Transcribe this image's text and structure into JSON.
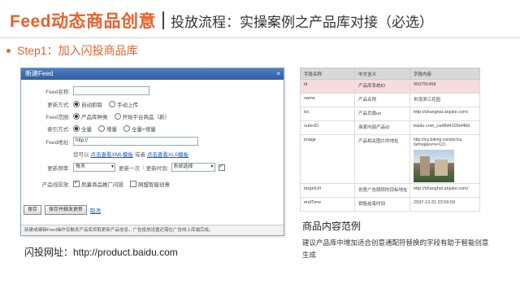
{
  "header": {
    "title_main": "Feed动态商品创意",
    "title_sub": "投放流程：实操案例之产品库对接（必选）"
  },
  "step": "Step1：加入闪投商品库",
  "dialog": {
    "title": "新建Feed",
    "close": "×",
    "feed_name_label": "Feed名称:",
    "update_mode_label": "更新方式:",
    "update_auto": "自动抓取",
    "update_manual": "手动上传",
    "scope_label": "Feed范围:",
    "scope_lib": "产品库种类",
    "scope_platform": "开始平台商品（新）",
    "index_label": "索引方式:",
    "index_full": "全量",
    "index_inc": "增量",
    "index_full_inc": "全量+增量",
    "addr_label": "Feed地址:",
    "addr_value": "http://",
    "tpl_prefix": "您可以",
    "tpl_xml": "点击查看XML模板",
    "tpl_or": "或者",
    "tpl_xls": "点击查看XLS模板",
    "freq_label": "更新频率:",
    "freq_value": "每天",
    "freq_once": "更新一次",
    "freq_until": "更新时到:",
    "freq_select": "系统选择",
    "product_label": "产品线投放:",
    "product_chk1": "凤巢商品推广闪投",
    "product_chk2": "网盟智能创意",
    "save": "保存",
    "save_update": "保存并触发更新",
    "cancel": "取消",
    "footer": "新建或编辑Feed操作仅触发产品库抓取更新产品信息，广告投放设置还需在广告线上库端完成。"
  },
  "url_text": "闪投网址：http://product.baidu.com",
  "table": {
    "headers": [
      "字段名称",
      "中文含义",
      "字段内容"
    ],
    "rows": [
      {
        "field": "id",
        "meaning": "产品库系统ID",
        "value": "959755458"
      },
      {
        "field": "name",
        "meaning": "产品名称",
        "value": "世茂滨江花园"
      },
      {
        "field": "loc",
        "meaning": "产品页面url",
        "value": "http://shanghai.anjuke.com/"
      },
      {
        "field": "outerID",
        "meaning": "商家内部产品ID",
        "value": "baidu.com_ca48d4105ef46b"
      },
      {
        "field": "image",
        "meaning": "产品相关图片的地址",
        "value": "http://ms.bdimg.com/pic/cu 6ef=pp&rx=s=121"
      },
      {
        "field": "targetUrl",
        "meaning": "创意广告跳转的目标地址",
        "value": "http://shanghai.anjuke.com/"
      },
      {
        "field": "endTime",
        "meaning": "销售结束时间",
        "value": "2037-12-31 23:59:59"
      }
    ]
  },
  "example": {
    "title": "商品内容范例",
    "desc": "建议产品库中增加适合创意通配符替换的字段有助于智能创意生成"
  }
}
